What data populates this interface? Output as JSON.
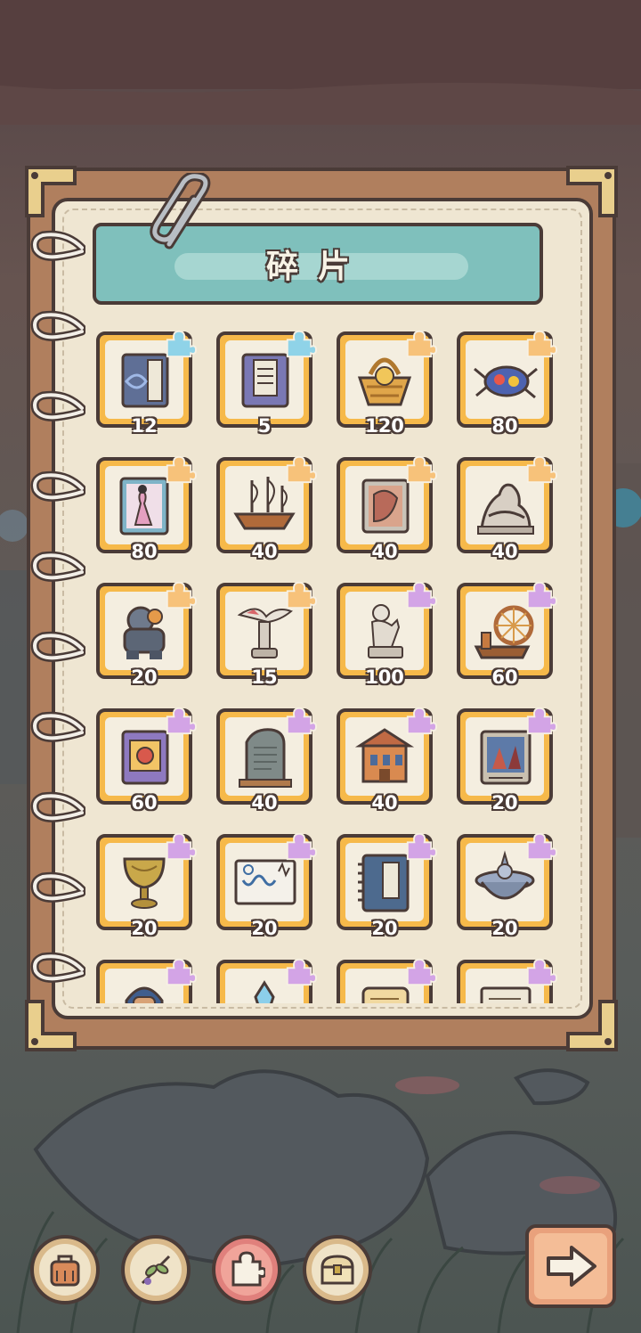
{
  "header": {
    "title": "碎片"
  },
  "colors": {
    "frame_dark": "#4a3b37",
    "notebook_brown": "#b07f5e",
    "paper": "#efe6d2",
    "banner_teal": "#7fc0bc",
    "card_gold": "#f6b94a",
    "puzzle_blue": "#8fd3e8",
    "puzzle_orange": "#f7c27a",
    "puzzle_purple": "#d3a4e6",
    "active_tab": "#e0807c"
  },
  "fragments": [
    {
      "icon": "calligraphy-book-icon",
      "count": "12",
      "rarity": "blue"
    },
    {
      "icon": "scripture-book-icon",
      "count": "5",
      "rarity": "blue"
    },
    {
      "icon": "woven-basket-icon",
      "count": "120",
      "rarity": "orange"
    },
    {
      "icon": "jeweled-beetle-icon",
      "count": "80",
      "rarity": "orange"
    },
    {
      "icon": "lady-painting-book-icon",
      "count": "80",
      "rarity": "orange"
    },
    {
      "icon": "sailing-ship-icon",
      "count": "40",
      "rarity": "orange"
    },
    {
      "icon": "portrait-painting-icon",
      "count": "40",
      "rarity": "orange"
    },
    {
      "icon": "pieta-statue-icon",
      "count": "40",
      "rarity": "orange"
    },
    {
      "icon": "rock-golem-icon",
      "count": "20",
      "rarity": "orange"
    },
    {
      "icon": "bird-statue-icon",
      "count": "15",
      "rarity": "orange"
    },
    {
      "icon": "cherub-statue-icon",
      "count": "100",
      "rarity": "purple"
    },
    {
      "icon": "spinning-wheel-icon",
      "count": "60",
      "rarity": "purple"
    },
    {
      "icon": "ornate-book-icon",
      "count": "60",
      "rarity": "purple"
    },
    {
      "icon": "stone-tablet-icon",
      "count": "40",
      "rarity": "purple"
    },
    {
      "icon": "ancient-building-icon",
      "count": "40",
      "rarity": "purple"
    },
    {
      "icon": "battle-painting-icon",
      "count": "20",
      "rarity": "purple"
    },
    {
      "icon": "golden-goblet-icon",
      "count": "20",
      "rarity": "purple"
    },
    {
      "icon": "dna-document-icon",
      "count": "20",
      "rarity": "purple"
    },
    {
      "icon": "bound-manuscript-icon",
      "count": "20",
      "rarity": "purple"
    },
    {
      "icon": "spinning-top-icon",
      "count": "20",
      "rarity": "purple"
    },
    {
      "icon": "pharaoh-bust-icon",
      "count": "",
      "rarity": "purple"
    },
    {
      "icon": "crystal-icon",
      "count": "",
      "rarity": "purple"
    },
    {
      "icon": "scroll-icon",
      "count": "",
      "rarity": "purple"
    },
    {
      "icon": "ancient-letter-icon",
      "count": "",
      "rarity": "purple"
    }
  ],
  "bottom_nav": [
    {
      "icon": "backpack-icon",
      "active": false
    },
    {
      "icon": "herb-branch-icon",
      "active": false
    },
    {
      "icon": "puzzle-piece-icon",
      "active": true
    },
    {
      "icon": "treasure-chest-icon",
      "active": false
    }
  ],
  "next_button": {
    "icon": "right-arrow-icon"
  }
}
